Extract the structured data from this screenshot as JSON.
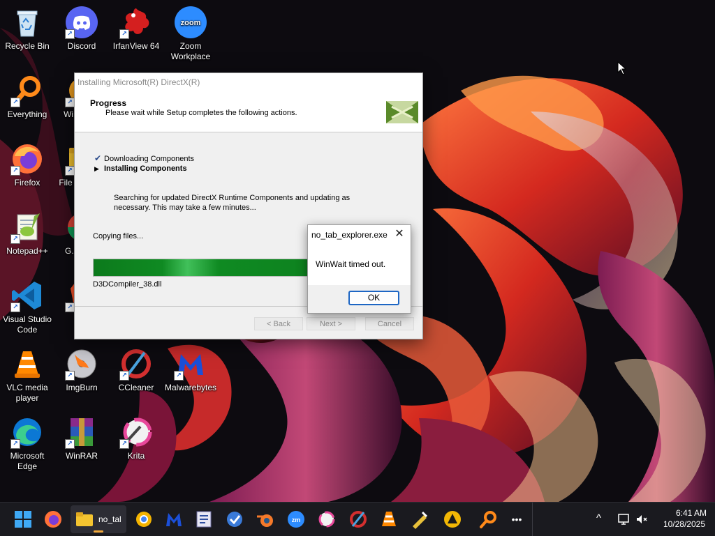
{
  "desktop": {
    "icons": [
      {
        "label": "Recycle Bin",
        "icon": "recycle-bin-icon"
      },
      {
        "label": "Discord",
        "icon": "discord-icon"
      },
      {
        "label": "IrfanView 64",
        "icon": "irfanview-icon"
      },
      {
        "label": "Zoom Workplace",
        "icon": "zoom-icon",
        "glyph": "zoom"
      },
      {
        "label": "Everything",
        "icon": "everything-icon"
      },
      {
        "label": "Wi... Tw...",
        "icon": "partially-hidden-icon"
      },
      {
        "label": "Firefox",
        "icon": "firefox-icon"
      },
      {
        "label": "File ... (No...",
        "icon": "file-explorer-icon"
      },
      {
        "label": "Notepad++",
        "icon": "notepadpp-icon"
      },
      {
        "label": "G... Ch...",
        "icon": "chrome-icon"
      },
      {
        "label": "Visual Studio Code",
        "icon": "vscode-icon"
      },
      {
        "label": "B...",
        "icon": "brave-icon"
      },
      {
        "label": "VLC media player",
        "icon": "vlc-icon"
      },
      {
        "label": "ImgBurn",
        "icon": "imgburn-icon"
      },
      {
        "label": "CCleaner",
        "icon": "ccleaner-icon"
      },
      {
        "label": "Malwarebytes",
        "icon": "malwarebytes-icon"
      },
      {
        "label": "Microsoft Edge",
        "icon": "edge-icon"
      },
      {
        "label": "WinRAR",
        "icon": "winrar-icon"
      },
      {
        "label": "Krita",
        "icon": "krita-icon"
      }
    ]
  },
  "installer": {
    "title": "Installing Microsoft(R) DirectX(R)",
    "header_title": "Progress",
    "header_subtitle": "Please wait while Setup completes the following actions.",
    "steps": [
      {
        "label": "Downloading Components",
        "marker": "✔",
        "state": "done"
      },
      {
        "label": "Installing Components",
        "marker": "▶",
        "state": "current"
      }
    ],
    "description": "Searching for updated DirectX Runtime Components and updating as necessary. This may take a few minutes...",
    "status": "Copying files...",
    "progress_fraction": 1.0,
    "current_file": "D3DCompiler_38.dll",
    "buttons": {
      "back": "< Back",
      "next": "Next >",
      "cancel": "Cancel"
    }
  },
  "message_box": {
    "title": "no_tab_explorer.exe",
    "close_glyph": "✕",
    "message": "WinWait timed out.",
    "ok": "OK"
  },
  "taskbar": {
    "active_window_label": "no_tal",
    "pinned": [
      "start-icon",
      "firefox-icon",
      "file-explorer-icon",
      "chrome-icon",
      "malwarebytes-icon",
      "app-icon",
      "security-icon",
      "blender-icon",
      "zoom-icon",
      "krita-icon",
      "ccleaner-icon",
      "vlc-icon",
      "tools-icon",
      "aimp-icon",
      "everything-icon",
      "more-icon"
    ],
    "zoom_text": "zm",
    "overflow": "•••",
    "tray_chevron": "^",
    "time": "6:41 AM",
    "date": "10/28/2025"
  },
  "colors": {
    "progress_green": "#0c7a1c",
    "ok_border": "#1d66c4",
    "taskbar_bg": "#1a1a1f"
  }
}
